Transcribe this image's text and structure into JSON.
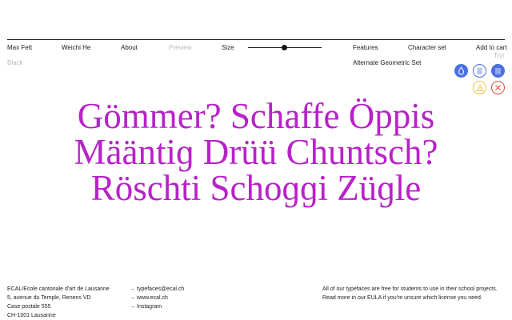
{
  "nav": {
    "designer_1": "Max Fett",
    "designer_2": "Weichi He",
    "about": "About",
    "preview": "Preview",
    "size": "Size",
    "features": "Features",
    "character_set": "Character set",
    "add_to_cart": "Add to cart"
  },
  "preview": {
    "weight": "Black",
    "feature_selected": "Alternate Geometric Set",
    "trial_label": "Tryi",
    "text_color": "#b822c9",
    "lines": [
      "Gömmer? Schaffe Öppis",
      "Määntiɡ Drüü Chuntsch?",
      "Röschti Schoɡɡi Züɡle"
    ]
  },
  "toolbar": {
    "icons": [
      "drop-icon",
      "align-center-icon",
      "align-justify-icon",
      "warning-icon",
      "close-icon"
    ],
    "colors": {
      "blue": "#4a6fe0",
      "yellow": "#f0c23a",
      "red": "#e6453c"
    }
  },
  "footer": {
    "address": [
      "ECAL/Ecole cantonale d'art de Lausanne",
      "5, avenue du Temple, Renens VD",
      "Case postale 555",
      "CH-1001 Lausanne"
    ],
    "links": [
      "typefaces@ecal.ch",
      "www.ecal.ch",
      "Instagram"
    ],
    "arrow": "→",
    "license_line_1": "All of our typefaces are free for students to use in their school projects.",
    "license_line_2": "Read more in our EULA if you're unsure which license you need."
  }
}
